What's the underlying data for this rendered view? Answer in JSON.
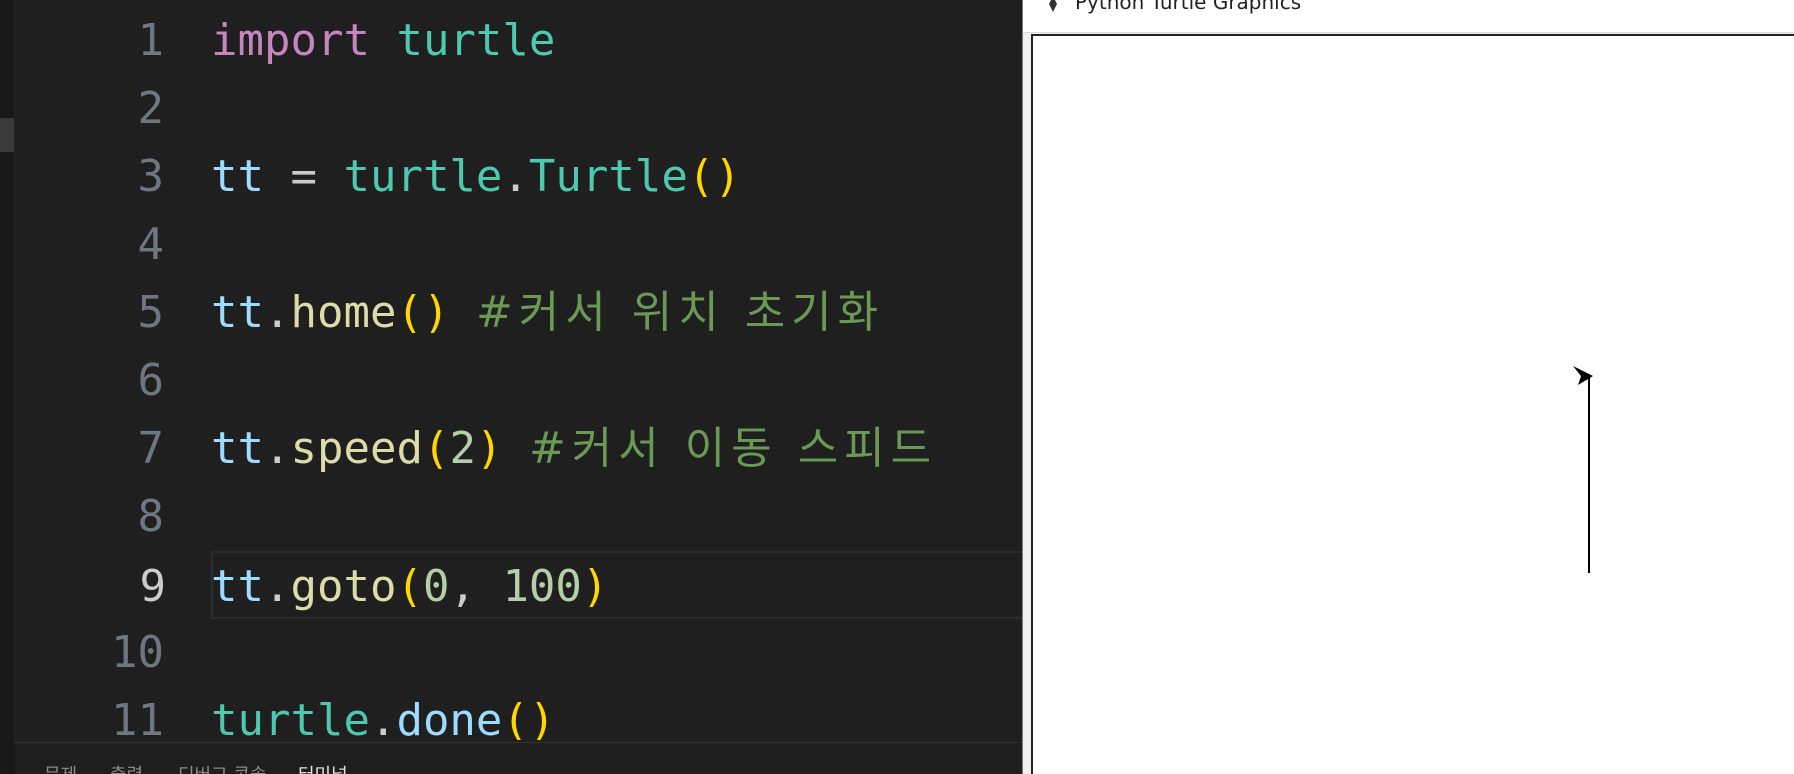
{
  "editor": {
    "lines": [
      {
        "n": "1",
        "tokens": [
          [
            "kw",
            "import"
          ],
          [
            "op",
            " "
          ],
          [
            "mod",
            "turtle"
          ]
        ]
      },
      {
        "n": "2",
        "tokens": []
      },
      {
        "n": "3",
        "tokens": [
          [
            "var",
            "tt"
          ],
          [
            "op",
            " = "
          ],
          [
            "mod",
            "turtle"
          ],
          [
            "op",
            "."
          ],
          [
            "mod",
            "Turtle"
          ],
          [
            "par",
            "()"
          ]
        ]
      },
      {
        "n": "4",
        "tokens": []
      },
      {
        "n": "5",
        "tokens": [
          [
            "var",
            "tt"
          ],
          [
            "op",
            "."
          ],
          [
            "fn",
            "home"
          ],
          [
            "par",
            "()"
          ],
          [
            "op",
            " "
          ],
          [
            "cmt",
            "#커서 위치 초기화"
          ]
        ]
      },
      {
        "n": "6",
        "tokens": []
      },
      {
        "n": "7",
        "tokens": [
          [
            "var",
            "tt"
          ],
          [
            "op",
            "."
          ],
          [
            "fn",
            "speed"
          ],
          [
            "par",
            "("
          ],
          [
            "num",
            "2"
          ],
          [
            "par",
            ")"
          ],
          [
            "op",
            " "
          ],
          [
            "cmt",
            "#커서 이동 스피드"
          ]
        ]
      },
      {
        "n": "8",
        "tokens": []
      },
      {
        "n": "9",
        "tokens": [
          [
            "var",
            "tt"
          ],
          [
            "op",
            "."
          ],
          [
            "fn",
            "goto"
          ],
          [
            "par",
            "("
          ],
          [
            "num",
            "0"
          ],
          [
            "op",
            ", "
          ],
          [
            "num",
            "100"
          ],
          [
            "par",
            ")"
          ]
        ],
        "current": true
      },
      {
        "n": "10",
        "tokens": []
      },
      {
        "n": "11",
        "tokens": [
          [
            "mod",
            "turtle"
          ],
          [
            "op",
            "."
          ],
          [
            "var",
            "done"
          ],
          [
            "par",
            "()"
          ]
        ]
      }
    ]
  },
  "panel": {
    "tabs": [
      {
        "label": "문제",
        "active": false
      },
      {
        "label": "출력",
        "active": false
      },
      {
        "label": "디버그 콘솔",
        "active": false
      },
      {
        "label": "터미널",
        "active": true
      }
    ]
  },
  "turtle_window": {
    "title": "Python Turtle Graphics",
    "icon": "feather-icon",
    "turtle_icon": "turtle-arrow-icon",
    "line_color": "#000000"
  },
  "colors": {
    "editor_bg": "#1f1f1f",
    "keyword": "#c586c0",
    "module": "#4ec9b0",
    "variable": "#9cdcfe",
    "function": "#dcdcaa",
    "paren": "#ffd700",
    "number": "#b5cea8",
    "comment": "#6a9955"
  }
}
